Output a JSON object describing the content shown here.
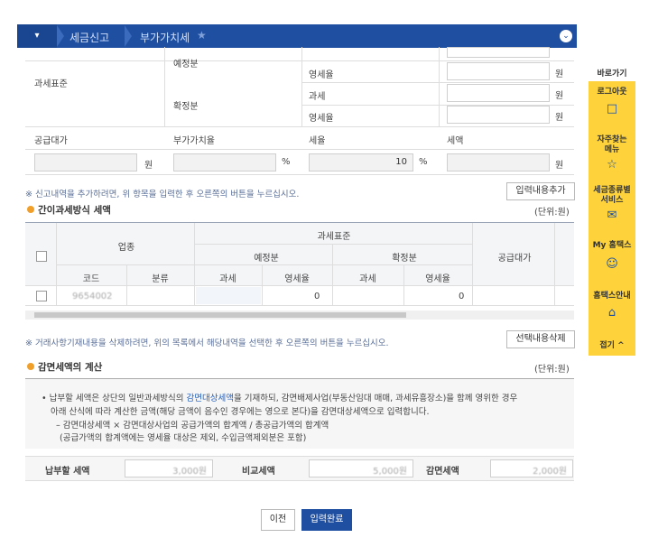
{
  "nav": {
    "menu_label": "▾",
    "crumb1": "세금신고",
    "crumb2": "부가가치세",
    "star": "★",
    "circle": "⌄"
  },
  "side_panel": {
    "items": [
      {
        "label": "바로가기"
      },
      {
        "label": "로그아웃"
      },
      {
        "label": "자주찾는\n메뉴"
      },
      {
        "label": "세금종류별\n서비스"
      },
      {
        "label": "My 홈택스"
      },
      {
        "label": "홈택스안내"
      },
      {
        "label": "접기 ^"
      }
    ]
  },
  "tax_table": {
    "row_label_base": "과세표준",
    "row_yejeong": "예정분",
    "row_hwakjeong": "확정분",
    "sub_yeongse_1": "영세율",
    "sub_gwase_2": "과세",
    "sub_yeongse_2": "영세율",
    "unit_won": "원",
    "col_supply": "공급대가",
    "col_vat_rate": "부가가치율",
    "col_tax_rate": "세율",
    "col_tax_amount": "세액",
    "supply_unit": "원",
    "vat_rate_unit": "%",
    "tax_rate_value": "10",
    "tax_rate_unit": "%",
    "tax_amount_unit": "원"
  },
  "note1": "※ 신고내역을 추가하려면, 위 항목을 입력한 후 오른쪽의 버튼을 누르십시오.",
  "add_button": "입력내용추가",
  "section1": {
    "title": "간이과세방식 세액",
    "unit": "(단위:원)"
  },
  "grid": {
    "h_industry": "업종",
    "h_base": "과세표준",
    "h_yejeong": "예정분",
    "h_hwakjeong": "확정분",
    "h_supply": "공급대가",
    "h_code": "코드",
    "h_class": "분류",
    "h_gwase1": "과세",
    "h_yeongse1": "영세율",
    "h_gwase2": "과세",
    "h_yeongse2": "영세율",
    "row_code": "9654002",
    "row_yeongse1": "0",
    "row_yeongse2": "0"
  },
  "note2": "※ 거래사항기재내용을 삭제하려면, 위의 목록에서 해당내역을 선택한 후 오른쪽의 버튼을 누르십시오.",
  "delete_button": "선택내용삭제",
  "section2": {
    "title": "감면세액의 계산",
    "unit": "(단위:원)"
  },
  "explain": {
    "line1_a": "• 납부할 세액은 상단의 일반과세방식의 ",
    "line1_link": "감면대상세액",
    "line1_b": "을 기재하되, 감면배제사업(부동산임대 매매, 과세유흥장소)을 함께 영위한 경우",
    "line2": "아래 산식에 따라 계산한 금액(해당 금액이 음수인 경우에는 영으로 본다)을 감면대상세액으로 입력합니다.",
    "line3": "– 감면대상세액 × 감면대상사업의 공급가액의 합계액 / 총공급가액의 합계액",
    "line4": "(공급가액의 합계액에는 영세율 대상은 제외, 수입금액제외분은 포함)"
  },
  "summary": {
    "pay_label": "납부할 세액",
    "pay_value": "3,000원",
    "compare_label": "비교세액",
    "compare_value": "5,000원",
    "reduce_label": "감면세액",
    "reduce_value": "2,000원"
  },
  "footer": {
    "prev": "이전",
    "done": "입력완료"
  }
}
